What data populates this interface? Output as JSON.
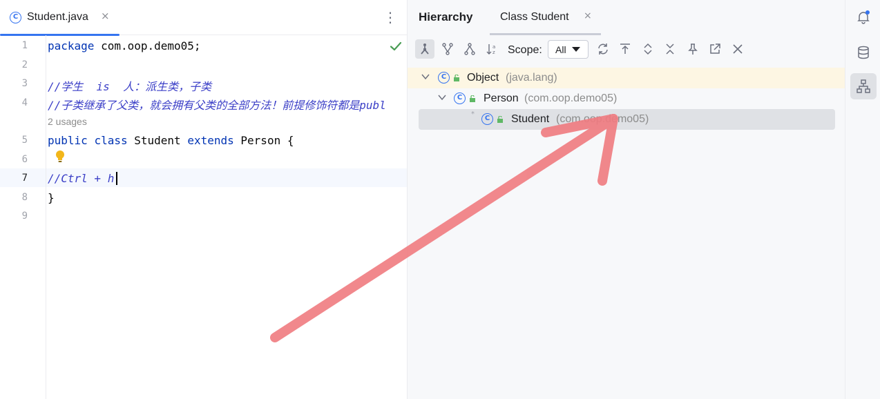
{
  "editor": {
    "tab": {
      "label": "Student.java",
      "icon": "class-icon",
      "close": "×"
    },
    "more": "⋮",
    "line_numbers": [
      "1",
      "2",
      "3",
      "4",
      "5",
      "6",
      "7",
      "8",
      "9"
    ],
    "lines": {
      "l1": {
        "keyword": "package",
        "rest": " com.oop.demo05;"
      },
      "l3": "//学生  is  人：派生类，子类",
      "l4": "//子类继承了父类，就会拥有父类的全部方法！前提修饰符都是publ",
      "usages": "2 usages",
      "l5": {
        "kw1": "public",
        "kw2": "class",
        "name": "Student",
        "kw3": "extends",
        "parent": "Person",
        "brace": "{"
      },
      "l7": "//Ctrl + h",
      "l8": "}"
    }
  },
  "hierarchy": {
    "title": "Hierarchy",
    "tab": {
      "label": "Class Student",
      "close": "×"
    },
    "toolbar": {
      "scope_label": "Scope:",
      "scope_value": "All",
      "buttons": [
        "class-hierarchy-icon",
        "supertypes-icon",
        "subtypes-icon",
        "sort-alpha-icon",
        "refresh-icon",
        "scroll-to-source-icon",
        "expand-all-icon",
        "collapse-all-icon",
        "pin-icon",
        "open-in-window-icon",
        "close-icon"
      ]
    },
    "tree": [
      {
        "name": "Object",
        "pkg": "(java.lang)"
      },
      {
        "name": "Person",
        "pkg": "(com.oop.demo05)"
      },
      {
        "name": "Student",
        "pkg": "(com.oop.demo05)"
      }
    ]
  },
  "right_strip": [
    "notifications-icon",
    "database-icon",
    "hierarchy-icon"
  ],
  "colors": {
    "accent": "#3574f0",
    "arrow": "#f07b80",
    "success": "#499c54"
  }
}
